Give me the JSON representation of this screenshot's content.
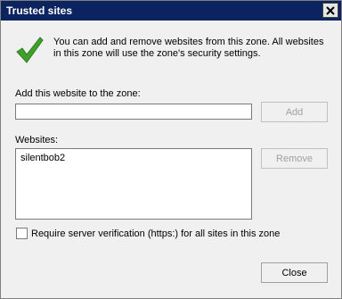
{
  "dialog": {
    "title": "Trusted sites",
    "info": "You can add and remove websites from this zone. All websites in this zone will use the zone's security settings."
  },
  "add_section": {
    "label": "Add this website to the zone:",
    "input_value": "",
    "add_button": "Add"
  },
  "websites": {
    "label": "Websites:",
    "items": [
      "silentbob2"
    ],
    "remove_button": "Remove"
  },
  "https_option": {
    "label": "Require server verification (https:) for all sites in this zone",
    "checked": false
  },
  "footer": {
    "close_button": "Close"
  },
  "colors": {
    "title_bar": "#0b2460",
    "check_green": "#3fa02a"
  }
}
